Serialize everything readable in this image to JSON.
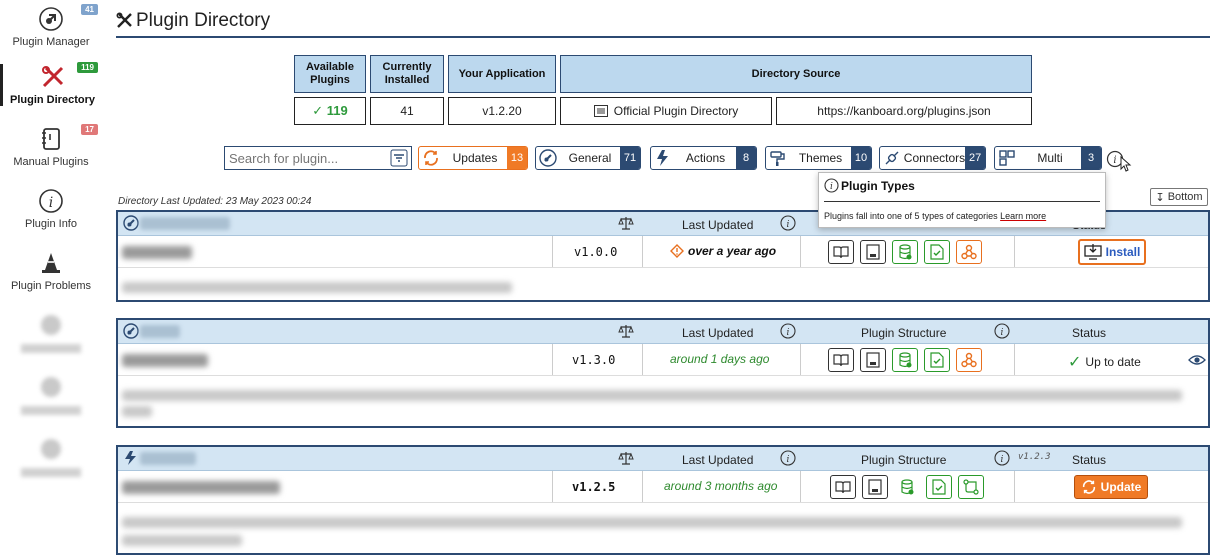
{
  "sidebar": {
    "items": [
      {
        "label": "Plugin Manager",
        "badge": "41",
        "badge_color": "#7fa3cc",
        "icon": "plugin-icon"
      },
      {
        "label": "Plugin Directory",
        "badge": "119",
        "badge_color": "#2e9a3c",
        "icon": "tools-icon"
      },
      {
        "label": "Manual Plugins",
        "badge": "17",
        "badge_color": "#e07878",
        "icon": "notebook-icon"
      },
      {
        "label": "Plugin Info",
        "icon": "info-icon"
      },
      {
        "label": "Plugin Problems",
        "icon": "cone-icon"
      }
    ]
  },
  "header": {
    "title": "Plugin Directory"
  },
  "summary": {
    "available_label": "Available Plugins",
    "available_value": "✓ 119",
    "installed_label": "Currently Installed",
    "installed_value": "41",
    "app_label": "Your Application",
    "app_value": "v1.2.20",
    "source_label": "Directory Source",
    "source_name": "Official Plugin Directory",
    "source_url": "https://kanboard.org/plugins.json"
  },
  "filters": {
    "search_placeholder": "Search for plugin...",
    "buttons": [
      {
        "label": "Updates",
        "count": "13"
      },
      {
        "label": "General",
        "count": "71"
      },
      {
        "label": "Actions",
        "count": "8"
      },
      {
        "label": "Themes",
        "count": "10"
      },
      {
        "label": "Connectors",
        "count": "27"
      },
      {
        "label": "Multi",
        "count": "3"
      }
    ]
  },
  "tooltip": {
    "title": "Plugin Types",
    "body": "Plugins fall into one of 5 types of categories",
    "link": "Learn more"
  },
  "directory_updated": "Directory Last Updated: 23 May 2023 00:24",
  "bottom_button": "Bottom",
  "columns": {
    "last_updated": "Last Updated",
    "structure": "Plugin Structure",
    "status": "Status"
  },
  "plugins": [
    {
      "version": "v1.0.0",
      "updated": "over a year ago",
      "action": "Install"
    },
    {
      "version": "v1.3.0",
      "updated": "around 1 days ago",
      "status": "Up to date"
    },
    {
      "version": "v1.2.5",
      "updated": "around 3 months ago",
      "action": "Update",
      "latest_version": "v1.2.3"
    }
  ],
  "colors": {
    "accent": "#2c4a72",
    "header_bg": "#bcd8ee",
    "orange": "#f07a26",
    "green": "#2e9a3c"
  }
}
